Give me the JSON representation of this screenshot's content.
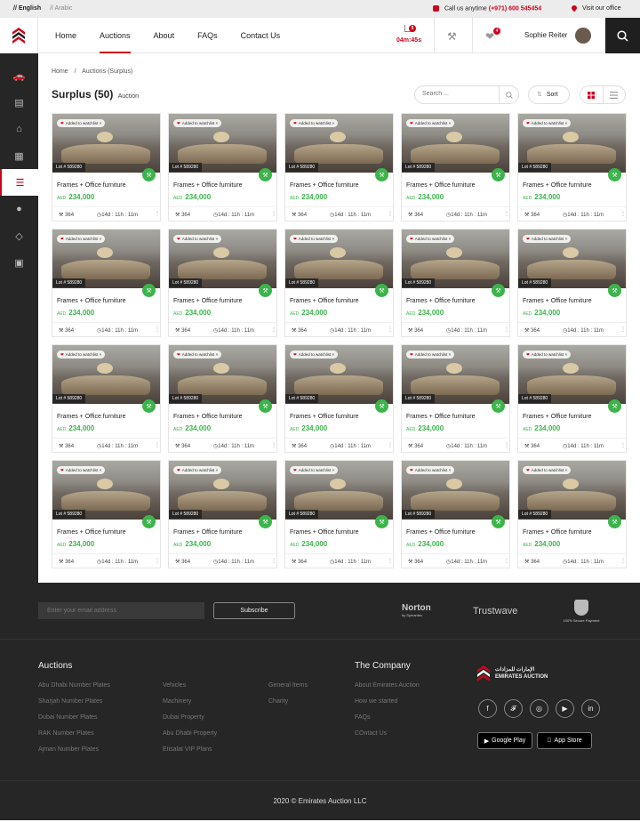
{
  "topbar": {
    "lang_en": "// English",
    "lang_ar": "// Arabic",
    "call_label": "Call us anytime",
    "call_number": "(+971) 600 545454",
    "office": "Visit our office"
  },
  "nav": {
    "items": [
      "Home",
      "Auctions",
      "About",
      "FAQs",
      "Contact Us"
    ],
    "active": "Auctions"
  },
  "header": {
    "timer": "04m:45s",
    "cart_count": "5",
    "watch_count": "4",
    "user_name": "Sophie Reiter"
  },
  "sidebar": {
    "icons": [
      "car-icon",
      "plate-icon",
      "home-icon",
      "building-icon",
      "layers-icon",
      "palette-icon",
      "diamond-icon",
      "bus-icon"
    ],
    "active_index": 4
  },
  "breadcrumb": [
    "Home",
    "Auctions (Surplus)"
  ],
  "page": {
    "title": "Surplus (50)",
    "subtitle": "Auction",
    "search_placeholder": "Search ...",
    "sort_label": "Sort"
  },
  "card": {
    "watch_label": "Added to watchlist",
    "lot": "Lot # 589280",
    "name": "Frames + Office furniture",
    "currency": "AED",
    "price": "234,000",
    "bids": "364",
    "time": "14d : 11h : 11m"
  },
  "newsletter": {
    "placeholder": "Enter your email address",
    "button": "Subscribe"
  },
  "badges": {
    "norton": "Norton",
    "norton_sub": "by Symantec",
    "trustwave": "Trustwave",
    "secure": "100% Secure Payment"
  },
  "footer": {
    "auctions_title": "Auctions",
    "col1": [
      "Abu Dhabi Number Plates",
      "Sharjah Number Plates",
      "Dubai Number Plates",
      "RAK Number Plates",
      "Ajman Number Plates"
    ],
    "col2": [
      "Vehicles",
      "Machinery",
      "Dubai Property",
      "Abu Dhabi Property",
      "Etisalat VIP Plans"
    ],
    "col3": [
      "General Items",
      "Charity"
    ],
    "company_title": "The Company",
    "company": [
      "About Emirates Auction",
      "How we started",
      "FAQs",
      "COntact Us"
    ],
    "logo_text_ar": "الإمارات للمزادات",
    "logo_text_en": "EMIRATES AUCTION",
    "social": [
      "f",
      "t",
      "ig",
      "yt",
      "in"
    ],
    "google_play": "Google Play",
    "app_store": "App Store",
    "copyright": "2020 © Emirates Auction LLC"
  },
  "colors": {
    "accent": "#d0021b",
    "green": "#3cb44b",
    "dark": "#262626"
  }
}
